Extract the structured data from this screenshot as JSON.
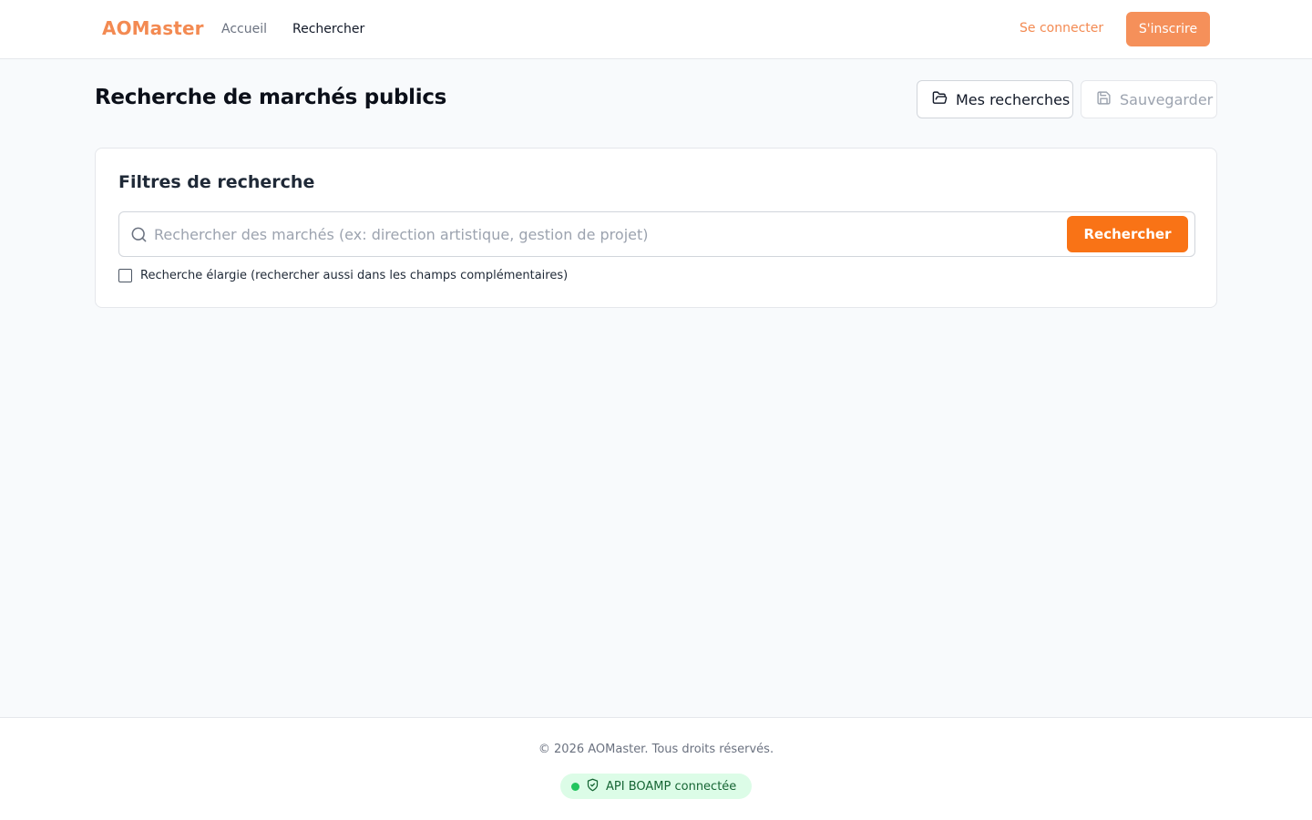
{
  "header": {
    "logo": "AOMaster",
    "nav": [
      {
        "label": "Accueil"
      },
      {
        "label": "Rechercher"
      }
    ],
    "login_label": "Se connecter",
    "signup_label": "S'inscrire"
  },
  "page": {
    "title": "Recherche de marchés publics",
    "my_searches_label": "Mes recherches",
    "save_label": "Sauvegarder"
  },
  "filters": {
    "title": "Filtres de recherche",
    "search_placeholder": "Rechercher des marchés (ex: direction artistique, gestion de projet)",
    "search_value": "",
    "search_button_label": "Rechercher",
    "extended_search_label": "Recherche élargie (rechercher aussi dans les champs complémentaires)",
    "extended_search_checked": false
  },
  "footer": {
    "copyright": "© 2026 AOMaster. Tous droits réservés.",
    "api_status": "API BOAMP connectée"
  },
  "colors": {
    "accent": "#f97316",
    "accent_soft": "#f5905a",
    "status_ok": "#22c55e",
    "status_bg": "#dcfce7"
  },
  "icons": {
    "my_searches": "folder-open-icon",
    "save": "floppy-disk-icon",
    "search": "search-icon",
    "api": "shield-check-icon"
  }
}
